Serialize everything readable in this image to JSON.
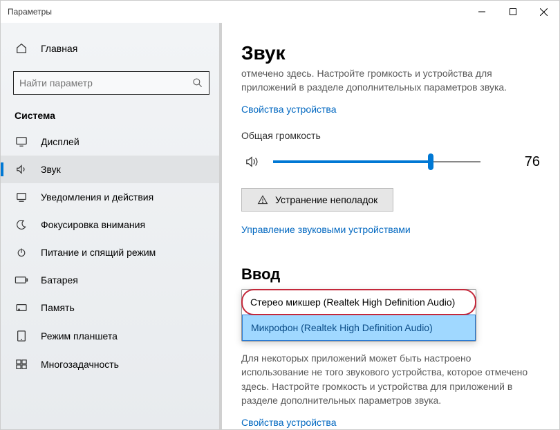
{
  "window": {
    "title": "Параметры"
  },
  "sidebar": {
    "home": "Главная",
    "search_placeholder": "Найти параметр",
    "section": "Система",
    "items": [
      {
        "label": "Дисплей"
      },
      {
        "label": "Звук"
      },
      {
        "label": "Уведомления и действия"
      },
      {
        "label": "Фокусировка внимания"
      },
      {
        "label": "Питание и спящий режим"
      },
      {
        "label": "Батарея"
      },
      {
        "label": "Память"
      },
      {
        "label": "Режим планшета"
      },
      {
        "label": "Многозадачность"
      }
    ]
  },
  "main": {
    "title": "Звук",
    "truncated_top": "отмечено здесь. Настройте громкость и устройства для приложений в разделе дополнительных параметров звука.",
    "device_props": "Свойства устройства",
    "volume_label": "Общая громкость",
    "volume_value": "76",
    "troubleshoot": "Устранение неполадок",
    "manage_devices": "Управление звуковыми устройствами",
    "input_heading": "Ввод",
    "input_options": {
      "opt0": "Стерео микшер (Realtek High Definition Audio)",
      "opt1": "Микрофон (Realtek High Definition Audio)"
    },
    "input_desc": "Для некоторых приложений может быть настроено использование не того звукового устройства, которое отмечено здесь. Настройте громкость и устройства для приложений в разделе дополнительных параметров звука.",
    "device_props2": "Свойства устройства"
  }
}
